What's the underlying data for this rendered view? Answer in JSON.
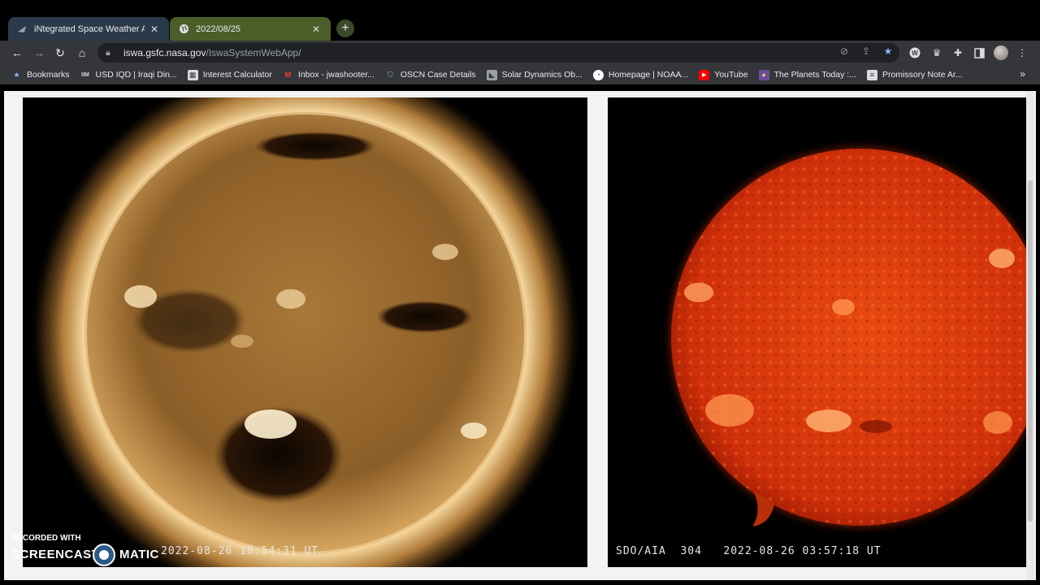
{
  "tabs": [
    {
      "title": "iNtegrated Space Weather Analy",
      "favicon": "nasa-icon",
      "active": false
    },
    {
      "title": "2022/08/25",
      "favicon": "globe-icon",
      "active": true
    }
  ],
  "address_bar": {
    "url_host": "iswa.gsfc.nasa.gov",
    "url_path": "/IswaSystemWebApp/"
  },
  "bookmarks": [
    {
      "label": "Bookmarks",
      "icon": "star-icon"
    },
    {
      "label": "USD IQD | Iraqi Din...",
      "icon": "site-icon"
    },
    {
      "label": "Interest Calculator",
      "icon": "calculator-icon"
    },
    {
      "label": "Inbox - jwashooter...",
      "icon": "gmail-icon"
    },
    {
      "label": "OSCN Case Details",
      "icon": "shield-icon"
    },
    {
      "label": "Solar Dynamics Ob...",
      "icon": "nasa-icon"
    },
    {
      "label": "Homepage | NOAA...",
      "icon": "noaa-icon"
    },
    {
      "label": "YouTube",
      "icon": "youtube-icon"
    },
    {
      "label": "The Planets Today :...",
      "icon": "planets-icon"
    },
    {
      "label": "Promissory Note Ar...",
      "icon": "document-icon"
    }
  ],
  "images": {
    "left": {
      "caption": "SDO/AIA 193  2022-08-26 18:54:31 UT",
      "visible_caption": "2022-08-26 18:54:31 UT",
      "color": "#c8964a"
    },
    "right": {
      "caption": "SDO/AIA  304   2022-08-26 03:57:18 UT",
      "color": "#e8400c"
    }
  },
  "watermark": {
    "line1": "RECORDED WITH",
    "line2a": "SCREENCAST",
    "line2b": "MATIC"
  }
}
